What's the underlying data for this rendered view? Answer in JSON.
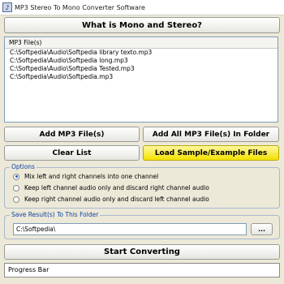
{
  "window": {
    "title": "MP3 Stereo To Mono Converter Software",
    "app_icon": "music-app-icon"
  },
  "help_button": "What is Mono and Stereo?",
  "file_list": {
    "header": "MP3 File(s)",
    "items": [
      "C:\\Softpedia\\Audio\\Softpedia library texto.mp3",
      "C:\\Softpedia\\Audio\\Softpedia long.mp3",
      "C:\\Softpedia\\Audio\\Softpedia Tested.mp3",
      "C:\\Softpedia\\Audio\\Softpedia.mp3"
    ]
  },
  "actions": {
    "add_files": "Add MP3 File(s)",
    "add_folder": "Add All MP3 File(s) In Folder",
    "clear_list": "Clear List",
    "load_sample": "Load Sample/Example Files"
  },
  "options": {
    "title": "Options",
    "items": [
      "Mix left and right channels into one channel",
      "Keep left channel audio only and discard right channel audio",
      "Keep right channel audio only and discard left channel audio"
    ],
    "selected_index": 0
  },
  "save": {
    "title": "Save Result(s) To This Folder",
    "path": "C:\\Softpedia\\",
    "browse_label": "..."
  },
  "start_button": "Start Converting",
  "progress_label": "Progress Bar",
  "colors": {
    "accent_yellow": "#f3e200",
    "group_title_blue": "#0b3ea6",
    "background": "#ece9d8"
  }
}
